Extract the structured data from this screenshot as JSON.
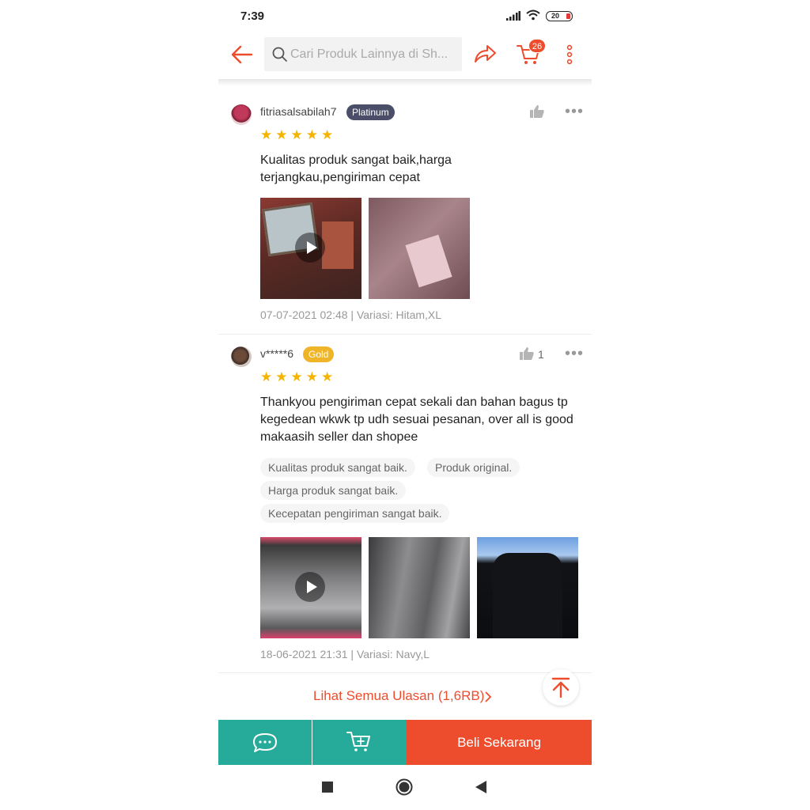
{
  "status_bar": {
    "time": "7:39",
    "battery": "20"
  },
  "top_bar": {
    "search_placeholder": "Cari Produk Lainnya di Sh...",
    "cart_count": "26"
  },
  "reviews": [
    {
      "username": "fitriasalsabilah7",
      "badge": "Platinum",
      "badge_color": "#4a4e69",
      "rating": 5,
      "text_lines": [
        "Kualitas produk sangat baik,harga",
        "terjangkau,pengiriman cepat"
      ],
      "like_count": "",
      "meta": "07-07-2021 02:48 | Variasi: Hitam,XL"
    },
    {
      "username": "v*****6",
      "badge": "Gold",
      "badge_color": "#f0b429",
      "rating": 5,
      "text_lines": [
        "Thankyou pengiriman cepat sekali dan bahan bagus tp",
        "kegedean wkwk tp udh sesuai pesanan, over all is good",
        "makaasih seller dan shopee"
      ],
      "tags": [
        "Kualitas produk sangat baik.",
        "Produk original.",
        "Harga produk sangat baik.",
        "Kecepatan pengiriman sangat baik."
      ],
      "like_count": "1",
      "meta": "18-06-2021 21:31 | Variasi: Navy,L"
    }
  ],
  "see_all": "Lihat Semua Ulasan (1,6RB)",
  "actions": {
    "buy_now": "Beli Sekarang"
  },
  "colors": {
    "brand": "#ee4d2d",
    "teal": "#26aa99",
    "star": "#f5b400"
  }
}
